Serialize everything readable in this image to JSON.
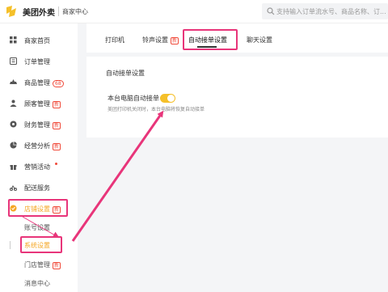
{
  "header": {
    "brand": "美团外卖",
    "subtitle": "商家中心",
    "search_placeholder": "支持输入订单流水号、商品名称、订..."
  },
  "sidebar": {
    "items": [
      {
        "label": "商家首页",
        "icon": "home-icon"
      },
      {
        "label": "订单管理",
        "icon": "order-icon"
      },
      {
        "label": "商品管理",
        "icon": "goods-icon",
        "badge": "68"
      },
      {
        "label": "顾客管理",
        "icon": "customer-icon",
        "badge": "新"
      },
      {
        "label": "财务管理",
        "icon": "finance-icon",
        "badge": "新"
      },
      {
        "label": "经营分析",
        "icon": "analysis-icon",
        "badge": "新"
      },
      {
        "label": "营销活动",
        "icon": "gift-icon"
      },
      {
        "label": "配送服务",
        "icon": "delivery-icon"
      },
      {
        "label": "店铺设置",
        "icon": "store-settings-icon",
        "badge": "新"
      }
    ],
    "sub_items": [
      {
        "label": "账号设置"
      },
      {
        "label": "系统设置"
      },
      {
        "label": "门店管理",
        "badge": "新"
      },
      {
        "label": "消息中心"
      }
    ]
  },
  "tabs": [
    {
      "label": "打印机"
    },
    {
      "label": "铃声设置",
      "badge": "新"
    },
    {
      "label": "自动接单设置"
    },
    {
      "label": "聊天设置"
    }
  ],
  "main": {
    "section_title": "自动接单设置",
    "setting_label": "本台电脑自动接单",
    "toggle_on": true,
    "setting_desc": "美团打印机关闭时，本台电脑将恢复自动接单"
  },
  "colors": {
    "accent": "#f5a623",
    "highlight": "#e8357a",
    "badge": "#f04a3a",
    "toggle": "#f5c02a"
  }
}
